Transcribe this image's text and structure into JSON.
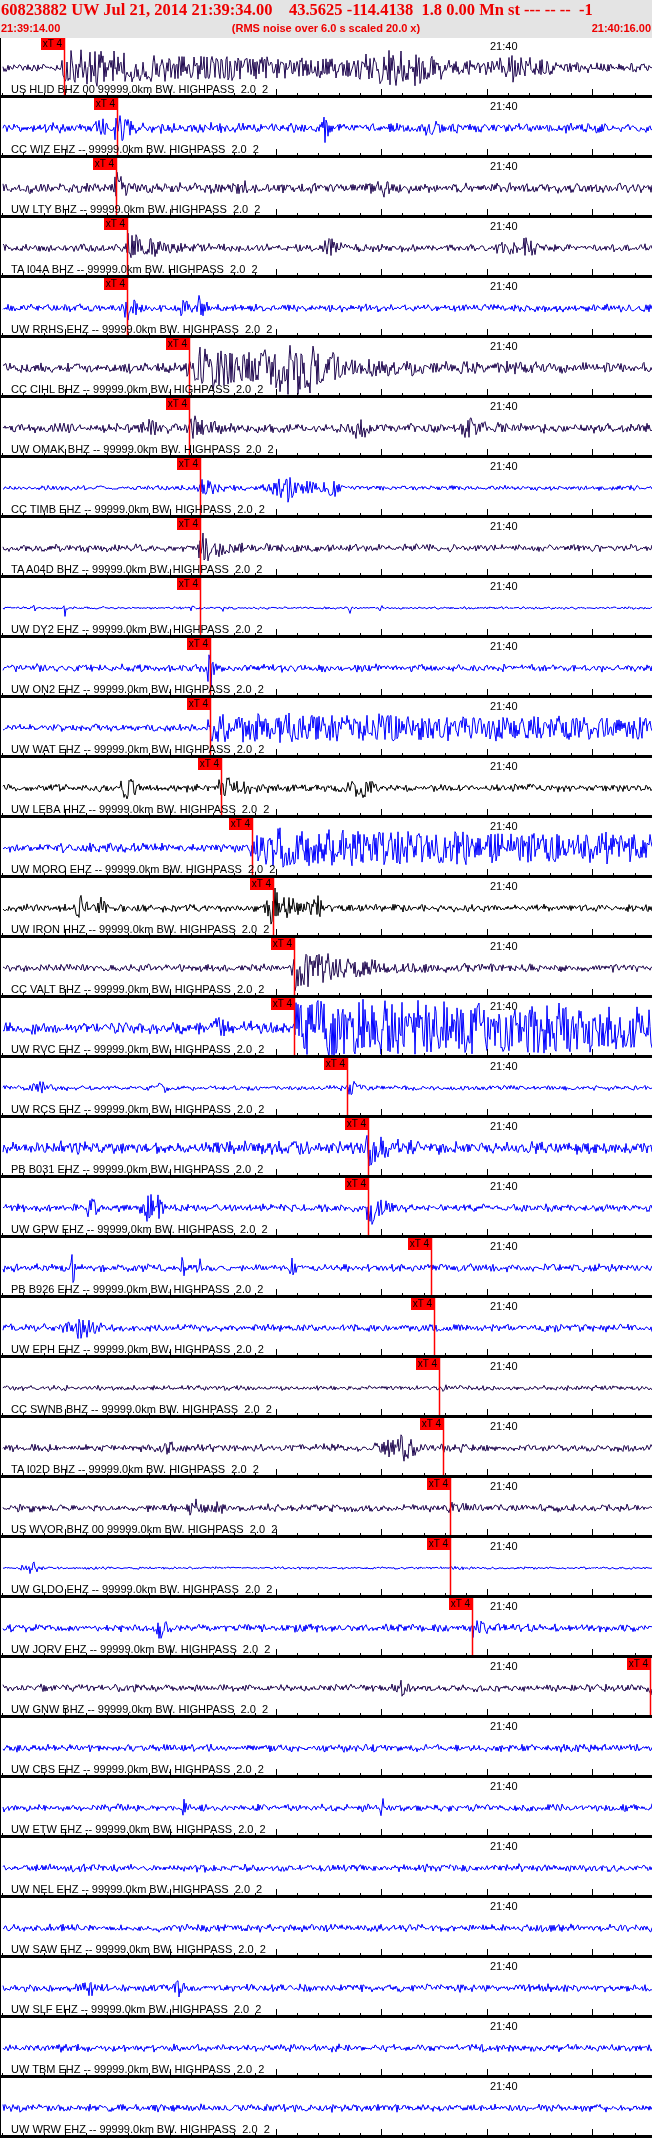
{
  "header": {
    "title": "60823882 UW Jul 21, 2014 21:39:34.00    43.5625 -114.4138  1.8 0.00 Mn st --- -- --  -1",
    "start_time": "21:39:14.00",
    "note": "(RMS noise over 6.0 s scaled 20.0 x)",
    "end_time": "21:40:16.00"
  },
  "traces": [
    {
      "label": "US HLID BHZ 00 99999.0km BW. HIGHPASS  2.0  2",
      "color": "#200850",
      "time_mark": "21:40",
      "pick": "xT 4"
    },
    {
      "label": "CC WIZ EHZ -- 99999.0km BW. HIGHPASS  2.0  2",
      "color": "#0000ff",
      "time_mark": "21:40",
      "pick": "xT 4"
    },
    {
      "label": "UW LTY BHZ -- 99999.0km BW. HIGHPASS  2.0  2",
      "color": "#200850",
      "time_mark": "21:40",
      "pick": "xT 4"
    },
    {
      "label": "TA I04A BHZ -- 99999.0km BW. HIGHPASS  2.0  2",
      "color": "#200850",
      "time_mark": "21:40",
      "pick": "xT 4"
    },
    {
      "label": "UW RRHS EHZ -- 99999.0km BW. HIGHPASS  2.0  2",
      "color": "#0000ff",
      "time_mark": "21:40",
      "pick": "xT 4"
    },
    {
      "label": "CC CIHL BHZ -- 99999.0km BW. HIGHPASS  2.0  2",
      "color": "#200850",
      "time_mark": "21:40",
      "pick": "xT 4"
    },
    {
      "label": "UW OMAK BHZ -- 99999.0km BW. HIGHPASS  2.0  2",
      "color": "#200850",
      "time_mark": "21:40",
      "pick": "xT 4"
    },
    {
      "label": "CC TIMB EHZ -- 99999.0km BW. HIGHPASS  2.0  2",
      "color": "#0000ff",
      "time_mark": "21:40",
      "pick": "xT 4"
    },
    {
      "label": "TA A04D BHZ -- 99999.0km BW. HIGHPASS  2.0  2",
      "color": "#200850",
      "time_mark": "21:40",
      "pick": "xT 4"
    },
    {
      "label": "UW DY2 EHZ -- 99999.0km BW. HIGHPASS  2.0  2",
      "color": "#0000ff",
      "time_mark": "21:40",
      "pick": "xT 4"
    },
    {
      "label": "UW ON2 EHZ -- 99999.0km BW. HIGHPASS  2.0  2",
      "color": "#0000ff",
      "time_mark": "21:40",
      "pick": "xT 4"
    },
    {
      "label": "UW WAT EHZ -- 99999.0km BW. HIGHPASS  2.0  2",
      "color": "#0000ff",
      "time_mark": "21:40",
      "pick": "xT 4"
    },
    {
      "label": "UW LEBA HHZ -- 99999.0km BW. HIGHPASS  2.0  2",
      "color": "#000000",
      "time_mark": "21:40",
      "pick": "xT 4"
    },
    {
      "label": "UW MORO EHZ -- 99999.0km BW. HIGHPASS  2.0  2",
      "color": "#0000ff",
      "time_mark": "21:40",
      "pick": "xT 4"
    },
    {
      "label": "UW IRON HHZ -- 99999.0km BW. HIGHPASS  2.0  2",
      "color": "#000000",
      "time_mark": "21:40",
      "pick": "xT 4"
    },
    {
      "label": "CC VALT BHZ -- 99999.0km BW. HIGHPASS  2.0  2",
      "color": "#200850",
      "time_mark": "21:40",
      "pick": "xT 4"
    },
    {
      "label": "UW RVC EHZ -- 99999.0km BW. HIGHPASS  2.0  2",
      "color": "#0000ff",
      "time_mark": "21:40",
      "pick": "xT 4"
    },
    {
      "label": "UW RCS EHZ -- 99999.0km BW. HIGHPASS  2.0  2",
      "color": "#0000ff",
      "time_mark": "21:40",
      "pick": "xT 4"
    },
    {
      "label": "PB B031 EHZ -- 99999.0km BW. HIGHPASS  2.0  2",
      "color": "#0000ff",
      "time_mark": "21:40",
      "pick": "xT 4"
    },
    {
      "label": "UW GPW EHZ -- 99999.0km BW. HIGHPASS  2.0  2",
      "color": "#0000ff",
      "time_mark": "21:40",
      "pick": "xT 4"
    },
    {
      "label": "PB B926 EHZ -- 99999.0km BW. HIGHPASS  2.0  2",
      "color": "#0000ff",
      "time_mark": "21:40",
      "pick": "xT 4"
    },
    {
      "label": "UW EPH EHZ -- 99999.0km BW. HIGHPASS  2.0  2",
      "color": "#0000ff",
      "time_mark": "21:40",
      "pick": "xT 4"
    },
    {
      "label": "CC SWNB BHZ -- 99999.0km BW. HIGHPASS  2.0  2",
      "color": "#200850",
      "time_mark": "21:40",
      "pick": "xT 4"
    },
    {
      "label": "TA I02D BHZ -- 99999.0km BW. HIGHPASS  2.0  2",
      "color": "#200850",
      "time_mark": "21:40",
      "pick": "xT 4"
    },
    {
      "label": "US WVOR BHZ 00 99999.0km BW. HIGHPASS  2.0  2",
      "color": "#200850",
      "time_mark": "21:40",
      "pick": "xT 4"
    },
    {
      "label": "UW GLDO EHZ -- 99999.0km BW. HIGHPASS  2.0  2",
      "color": "#0000ff",
      "time_mark": "21:40",
      "pick": "xT 4"
    },
    {
      "label": "UW JORV EHZ -- 99999.0km BW. HIGHPASS  2.0  2",
      "color": "#0000ff",
      "time_mark": "21:40",
      "pick": "xT 4"
    },
    {
      "label": "UW GNW BHZ -- 99999.0km BW. HIGHPASS  2.0  2",
      "color": "#200850",
      "time_mark": "21:40",
      "pick": "xT 4"
    },
    {
      "label": "UW CBS EHZ -- 99999.0km BW. HIGHPASS  2.0  2",
      "color": "#0000ff",
      "time_mark": "21:40"
    },
    {
      "label": "UW ETW EHZ -- 99999.0km BW. HIGHPASS  2.0  2",
      "color": "#0000ff",
      "time_mark": "21:40"
    },
    {
      "label": "UW NEL EHZ -- 99999.0km BW. HIGHPASS  2.0  2",
      "color": "#0000ff",
      "time_mark": "21:40"
    },
    {
      "label": "UW SAW EHZ -- 99999.0km BW. HIGHPASS  2.0  2",
      "color": "#0000ff",
      "time_mark": "21:40"
    },
    {
      "label": "UW SLF EHZ -- 99999.0km BW. HIGHPASS  2.0  2",
      "color": "#0000ff",
      "time_mark": "21:40"
    },
    {
      "label": "UW TBM EHZ -- 99999.0km BW. HIGHPASS  2.0  2",
      "color": "#0000ff",
      "time_mark": "21:40"
    },
    {
      "label": "UW WRW EHZ -- 99999.0km BW. HIGHPASS  2.0  2",
      "color": "#0000ff",
      "time_mark": "21:40"
    }
  ]
}
